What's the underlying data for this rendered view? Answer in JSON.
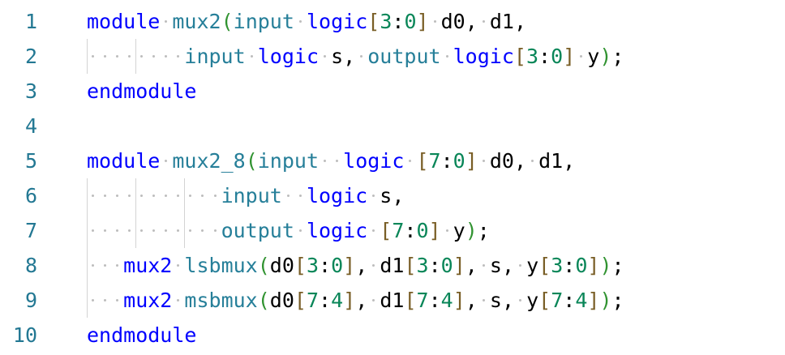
{
  "colors": {
    "keyword": "#0000ff",
    "type": "#267f99",
    "number": "#098658",
    "bracket1": "#795e26",
    "bracket2": "#319331",
    "plain": "#000000",
    "line_number": "#237893",
    "guide": "#d3d3d3",
    "whitespace": "#bdbdbd"
  },
  "editor": {
    "lines": [
      {
        "number": "1",
        "tokens": [
          {
            "t": "module",
            "c": "keyword"
          },
          {
            "t": " ",
            "c": "ws"
          },
          {
            "t": "mux2",
            "c": "type"
          },
          {
            "t": "(",
            "c": "bracket2"
          },
          {
            "t": "input",
            "c": "type"
          },
          {
            "t": " ",
            "c": "ws"
          },
          {
            "t": "logic",
            "c": "keyword"
          },
          {
            "t": "[",
            "c": "bracket1"
          },
          {
            "t": "3",
            "c": "number"
          },
          {
            "t": ":",
            "c": "plain"
          },
          {
            "t": "0",
            "c": "number"
          },
          {
            "t": "]",
            "c": "bracket1"
          },
          {
            "t": " ",
            "c": "ws"
          },
          {
            "t": "d0,",
            "c": "plain"
          },
          {
            "t": " ",
            "c": "ws"
          },
          {
            "t": "d1,",
            "c": "plain"
          }
        ]
      },
      {
        "number": "2",
        "indent": 8,
        "guides": [
          0,
          4
        ],
        "dots": 8,
        "tokens": [
          {
            "t": "input",
            "c": "type"
          },
          {
            "t": " ",
            "c": "ws"
          },
          {
            "t": "logic",
            "c": "keyword"
          },
          {
            "t": " ",
            "c": "ws"
          },
          {
            "t": "s,",
            "c": "plain"
          },
          {
            "t": " ",
            "c": "ws"
          },
          {
            "t": "output",
            "c": "type"
          },
          {
            "t": " ",
            "c": "ws"
          },
          {
            "t": "logic",
            "c": "keyword"
          },
          {
            "t": "[",
            "c": "bracket1"
          },
          {
            "t": "3",
            "c": "number"
          },
          {
            "t": ":",
            "c": "plain"
          },
          {
            "t": "0",
            "c": "number"
          },
          {
            "t": "]",
            "c": "bracket1"
          },
          {
            "t": " ",
            "c": "ws"
          },
          {
            "t": "y",
            "c": "plain"
          },
          {
            "t": ")",
            "c": "bracket2"
          },
          {
            "t": ";",
            "c": "plain"
          }
        ]
      },
      {
        "number": "3",
        "tokens": [
          {
            "t": "endmodule",
            "c": "keyword"
          }
        ]
      },
      {
        "number": "4",
        "tokens": []
      },
      {
        "number": "5",
        "tokens": [
          {
            "t": "module",
            "c": "keyword"
          },
          {
            "t": " ",
            "c": "ws"
          },
          {
            "t": "mux2_8",
            "c": "type"
          },
          {
            "t": "(",
            "c": "bracket2"
          },
          {
            "t": "input",
            "c": "type"
          },
          {
            "t": " ",
            "c": "ws"
          },
          {
            "t": " ",
            "c": "ws"
          },
          {
            "t": "logic",
            "c": "keyword"
          },
          {
            "t": " ",
            "c": "ws"
          },
          {
            "t": "[",
            "c": "bracket1"
          },
          {
            "t": "7",
            "c": "number"
          },
          {
            "t": ":",
            "c": "plain"
          },
          {
            "t": "0",
            "c": "number"
          },
          {
            "t": "]",
            "c": "bracket1"
          },
          {
            "t": " ",
            "c": "ws"
          },
          {
            "t": "d0,",
            "c": "plain"
          },
          {
            "t": " ",
            "c": "ws"
          },
          {
            "t": "d1,",
            "c": "plain"
          }
        ]
      },
      {
        "number": "6",
        "indent": 11,
        "guides": [
          0,
          4,
          8
        ],
        "dots": 11,
        "tokens": [
          {
            "t": "input",
            "c": "type"
          },
          {
            "t": " ",
            "c": "ws"
          },
          {
            "t": " ",
            "c": "ws"
          },
          {
            "t": "logic",
            "c": "keyword"
          },
          {
            "t": " ",
            "c": "ws"
          },
          {
            "t": "s,",
            "c": "plain"
          }
        ]
      },
      {
        "number": "7",
        "indent": 11,
        "guides": [
          0,
          4,
          8
        ],
        "dots": 11,
        "tokens": [
          {
            "t": "output",
            "c": "type"
          },
          {
            "t": " ",
            "c": "ws"
          },
          {
            "t": "logic",
            "c": "keyword"
          },
          {
            "t": " ",
            "c": "ws"
          },
          {
            "t": "[",
            "c": "bracket1"
          },
          {
            "t": "7",
            "c": "number"
          },
          {
            "t": ":",
            "c": "plain"
          },
          {
            "t": "0",
            "c": "number"
          },
          {
            "t": "]",
            "c": "bracket1"
          },
          {
            "t": " ",
            "c": "ws"
          },
          {
            "t": "y",
            "c": "plain"
          },
          {
            "t": ")",
            "c": "bracket2"
          },
          {
            "t": ";",
            "c": "plain"
          }
        ]
      },
      {
        "number": "8",
        "indent": 3,
        "guides": [
          0
        ],
        "dots": 3,
        "tokens": [
          {
            "t": "mux2",
            "c": "keyword"
          },
          {
            "t": " ",
            "c": "ws"
          },
          {
            "t": "lsbmux",
            "c": "type"
          },
          {
            "t": "(",
            "c": "bracket2"
          },
          {
            "t": "d0",
            "c": "plain"
          },
          {
            "t": "[",
            "c": "bracket1"
          },
          {
            "t": "3",
            "c": "number"
          },
          {
            "t": ":",
            "c": "plain"
          },
          {
            "t": "0",
            "c": "number"
          },
          {
            "t": "]",
            "c": "bracket1"
          },
          {
            "t": ",",
            "c": "plain"
          },
          {
            "t": " ",
            "c": "ws"
          },
          {
            "t": "d1",
            "c": "plain"
          },
          {
            "t": "[",
            "c": "bracket1"
          },
          {
            "t": "3",
            "c": "number"
          },
          {
            "t": ":",
            "c": "plain"
          },
          {
            "t": "0",
            "c": "number"
          },
          {
            "t": "]",
            "c": "bracket1"
          },
          {
            "t": ",",
            "c": "plain"
          },
          {
            "t": " ",
            "c": "ws"
          },
          {
            "t": "s,",
            "c": "plain"
          },
          {
            "t": " ",
            "c": "ws"
          },
          {
            "t": "y",
            "c": "plain"
          },
          {
            "t": "[",
            "c": "bracket1"
          },
          {
            "t": "3",
            "c": "number"
          },
          {
            "t": ":",
            "c": "plain"
          },
          {
            "t": "0",
            "c": "number"
          },
          {
            "t": "]",
            "c": "bracket1"
          },
          {
            "t": ")",
            "c": "bracket2"
          },
          {
            "t": ";",
            "c": "plain"
          }
        ]
      },
      {
        "number": "9",
        "indent": 3,
        "guides": [
          0
        ],
        "dots": 3,
        "tokens": [
          {
            "t": "mux2",
            "c": "keyword"
          },
          {
            "t": " ",
            "c": "ws"
          },
          {
            "t": "msbmux",
            "c": "type"
          },
          {
            "t": "(",
            "c": "bracket2"
          },
          {
            "t": "d0",
            "c": "plain"
          },
          {
            "t": "[",
            "c": "bracket1"
          },
          {
            "t": "7",
            "c": "number"
          },
          {
            "t": ":",
            "c": "plain"
          },
          {
            "t": "4",
            "c": "number"
          },
          {
            "t": "]",
            "c": "bracket1"
          },
          {
            "t": ",",
            "c": "plain"
          },
          {
            "t": " ",
            "c": "ws"
          },
          {
            "t": "d1",
            "c": "plain"
          },
          {
            "t": "[",
            "c": "bracket1"
          },
          {
            "t": "7",
            "c": "number"
          },
          {
            "t": ":",
            "c": "plain"
          },
          {
            "t": "4",
            "c": "number"
          },
          {
            "t": "]",
            "c": "bracket1"
          },
          {
            "t": ",",
            "c": "plain"
          },
          {
            "t": " ",
            "c": "ws"
          },
          {
            "t": "s,",
            "c": "plain"
          },
          {
            "t": " ",
            "c": "ws"
          },
          {
            "t": "y",
            "c": "plain"
          },
          {
            "t": "[",
            "c": "bracket1"
          },
          {
            "t": "7",
            "c": "number"
          },
          {
            "t": ":",
            "c": "plain"
          },
          {
            "t": "4",
            "c": "number"
          },
          {
            "t": "]",
            "c": "bracket1"
          },
          {
            "t": ")",
            "c": "bracket2"
          },
          {
            "t": ";",
            "c": "plain"
          }
        ]
      },
      {
        "number": "10",
        "tokens": [
          {
            "t": "endmodule",
            "c": "keyword"
          }
        ]
      }
    ]
  }
}
